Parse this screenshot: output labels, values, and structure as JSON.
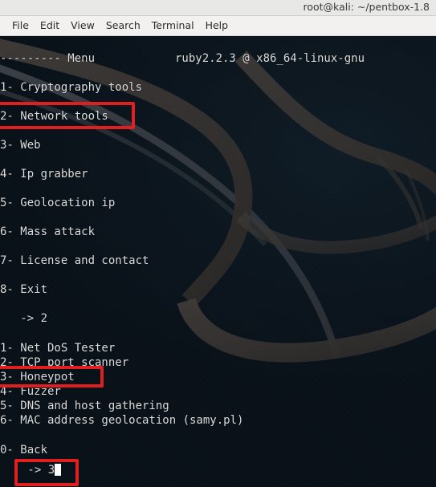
{
  "window": {
    "title": "root@kali: ~/pentbox-1.8"
  },
  "menubar": {
    "items": [
      {
        "label": "File"
      },
      {
        "label": "Edit"
      },
      {
        "label": "View"
      },
      {
        "label": "Search"
      },
      {
        "label": "Terminal"
      },
      {
        "label": "Help"
      }
    ]
  },
  "terminal": {
    "header": {
      "menu_rule": "--------- Menu",
      "ruby_version": "ruby2.2.3 @ x86_64-linux-gnu"
    },
    "main_menu": [
      {
        "label": "1- Cryptography tools"
      },
      {
        "label": "2- Network tools"
      },
      {
        "label": "3- Web"
      },
      {
        "label": "4- Ip grabber"
      },
      {
        "label": "5- Geolocation ip"
      },
      {
        "label": "6- Mass attack"
      },
      {
        "label": "7- License and contact"
      },
      {
        "label": "8- Exit"
      }
    ],
    "main_prompt": "   -> 2",
    "submenu": [
      {
        "label": "1- Net DoS Tester"
      },
      {
        "label": "2- TCP port scanner"
      },
      {
        "label": "3- Honeypot"
      },
      {
        "label": "4- Fuzzer"
      },
      {
        "label": "5- DNS and host gathering"
      },
      {
        "label": "6- MAC address geolocation (samy.pl)"
      }
    ],
    "back_option": "0- Back",
    "sub_prompt": " -> 3"
  },
  "annotations": {
    "highlight_color": "#e02020",
    "boxes": [
      {
        "name": "network-tools"
      },
      {
        "name": "honeypot"
      },
      {
        "name": "input-prompt"
      }
    ]
  },
  "colors": {
    "terminal_bg": "#0c1219",
    "terminal_fg": "#dcdcdc",
    "titlebar_bg": "#e8e8e7",
    "menubar_bg": "#f2f1f0",
    "accent_red": "#e02020"
  }
}
